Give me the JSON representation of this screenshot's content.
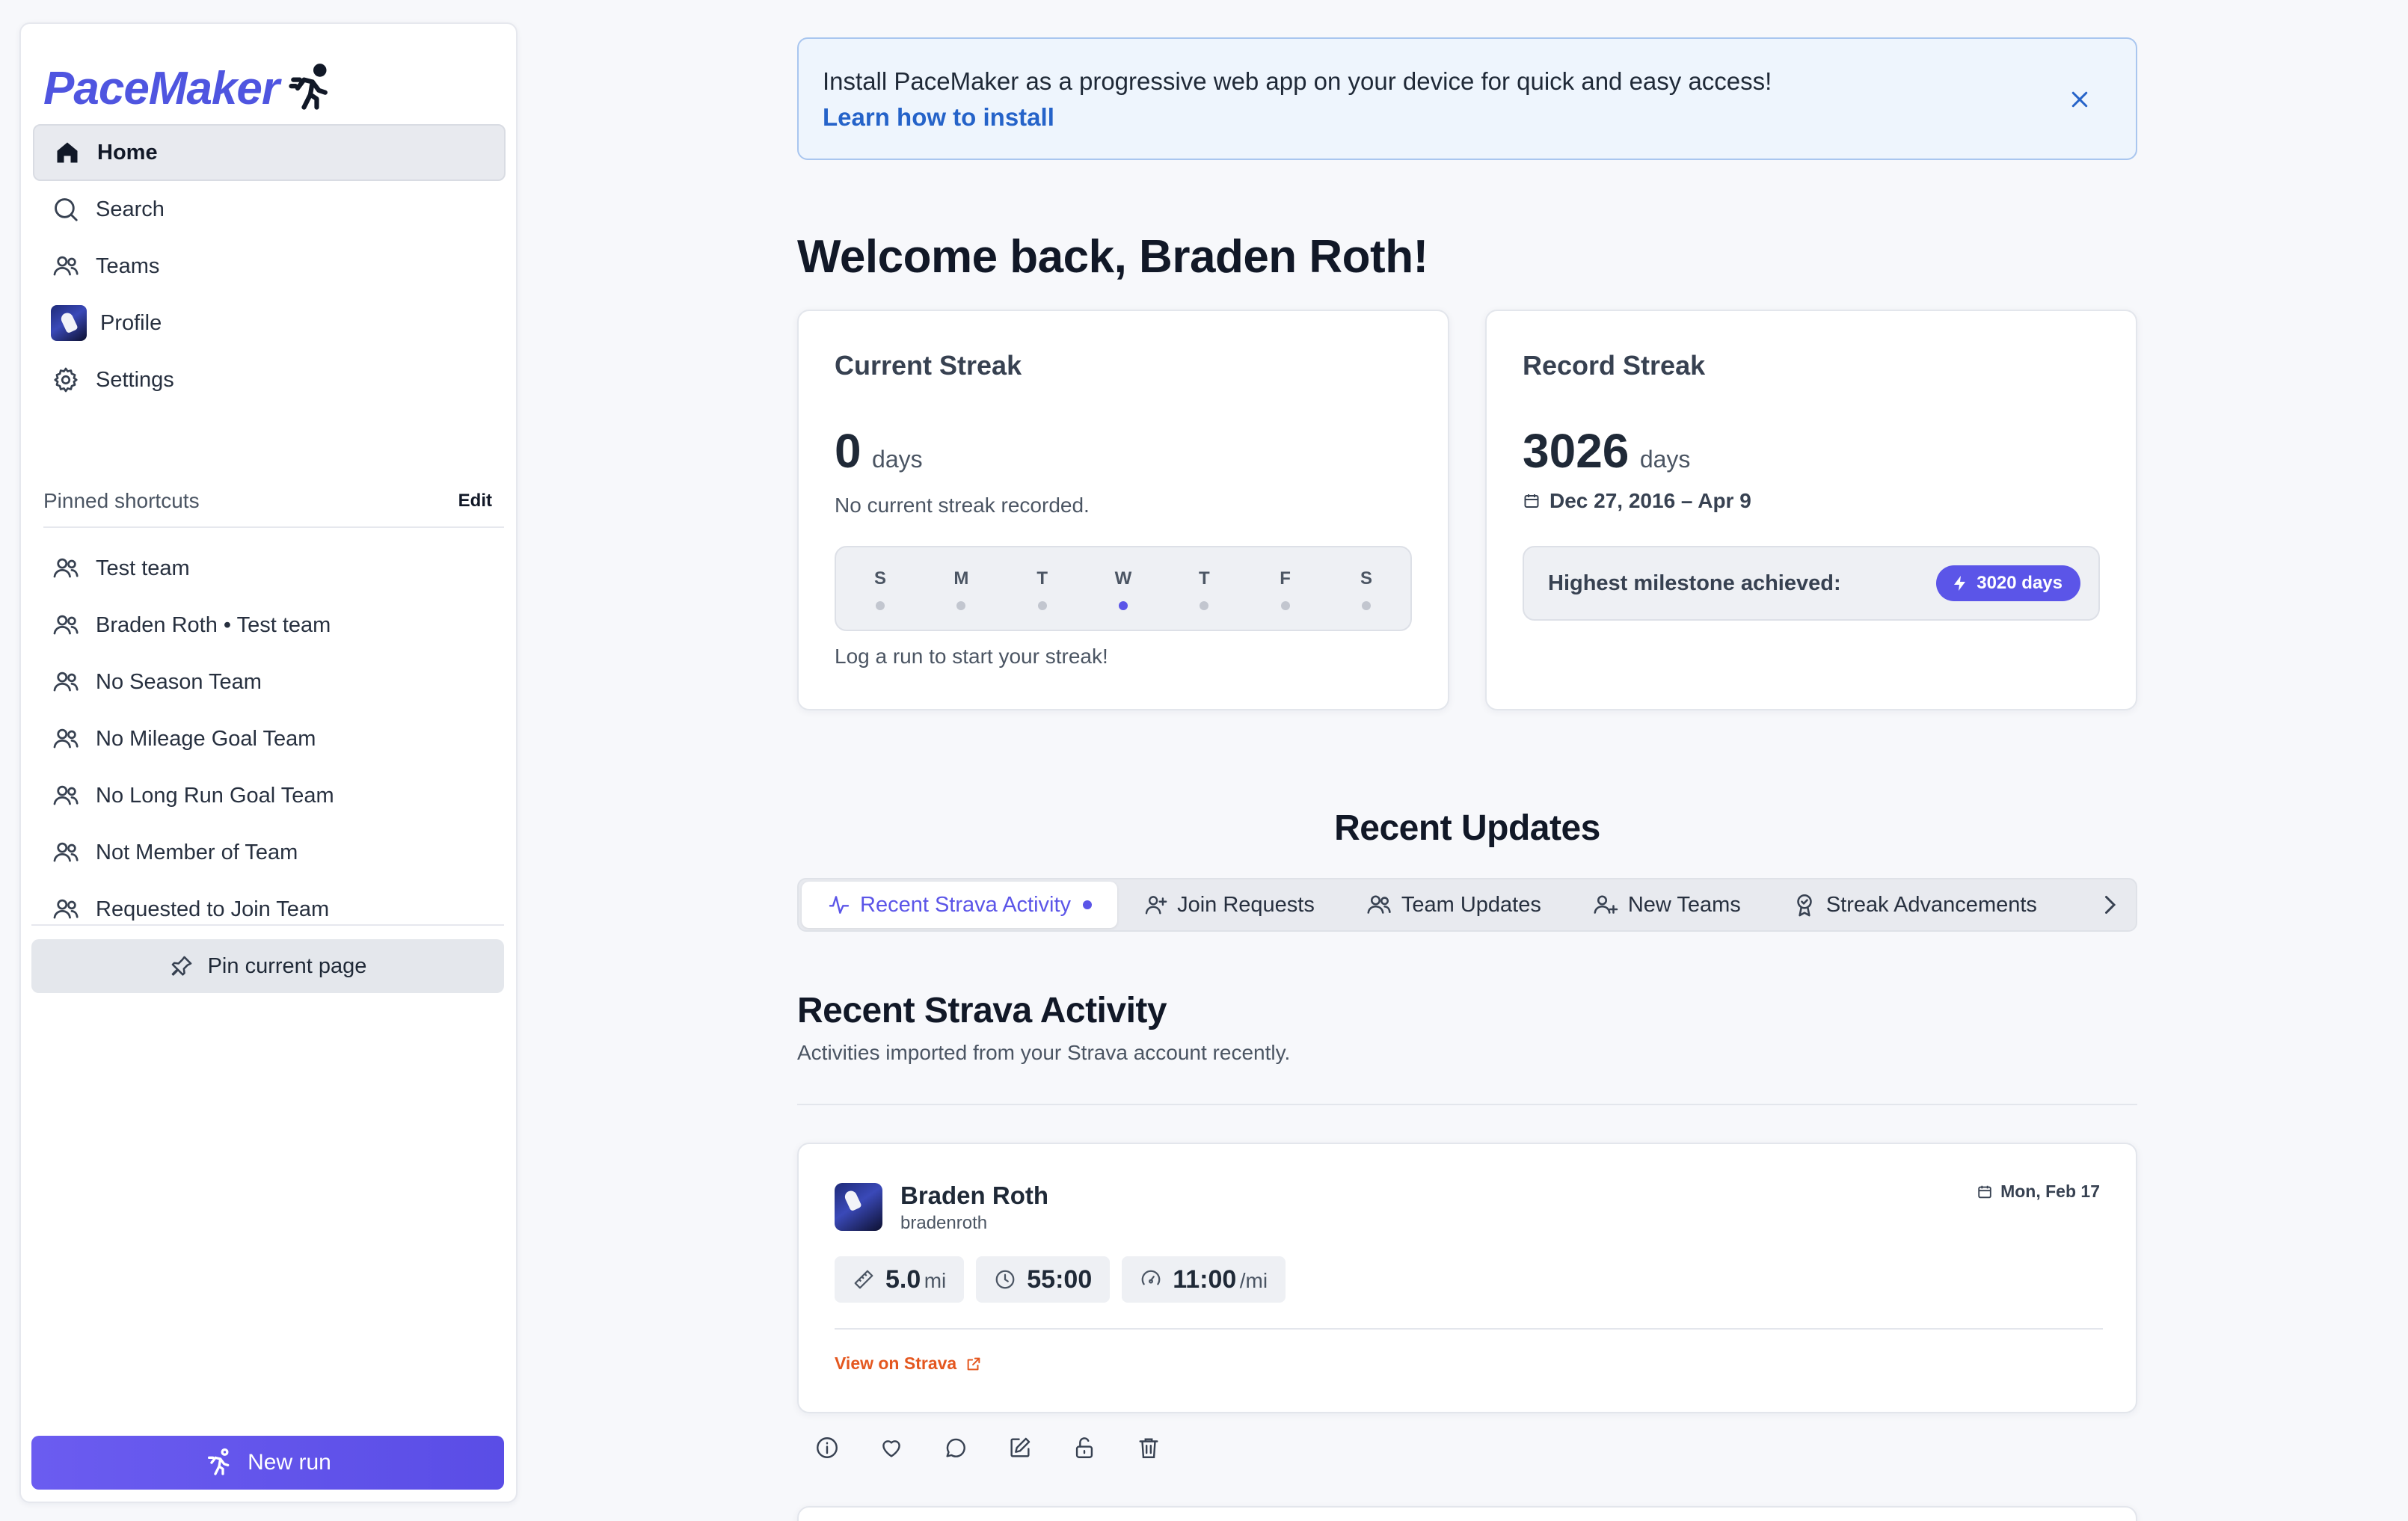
{
  "app": {
    "name": "PaceMaker"
  },
  "sidebar": {
    "nav": [
      {
        "label": "Home",
        "icon": "home-icon"
      },
      {
        "label": "Search",
        "icon": "search-icon"
      },
      {
        "label": "Teams",
        "icon": "users-icon"
      },
      {
        "label": "Profile",
        "icon": "avatar"
      },
      {
        "label": "Settings",
        "icon": "gear-icon"
      }
    ],
    "pinned_title": "Pinned shortcuts",
    "pinned_edit": "Edit",
    "pinned": [
      "Test team",
      "Braden Roth • Test team",
      "No Season Team",
      "No Mileage Goal Team",
      "No Long Run Goal Team",
      "Not Member of Team",
      "Requested to Join Team"
    ],
    "pin_button": "Pin current page",
    "new_run_button": "New run"
  },
  "banner": {
    "text": "Install PaceMaker as a progressive web app on your device for quick and easy access!",
    "link": "Learn how to install"
  },
  "welcome": "Welcome back, Braden Roth!",
  "current_streak": {
    "title": "Current Streak",
    "value": "0",
    "unit": "days",
    "note": "No current streak recorded.",
    "days": [
      "S",
      "M",
      "T",
      "W",
      "T",
      "F",
      "S"
    ],
    "today_index": 3,
    "cta": "Log a run to start your streak!"
  },
  "record_streak": {
    "title": "Record Streak",
    "value": "3026",
    "unit": "days",
    "range": "Dec 27, 2016 – Apr 9",
    "milestone_label": "Highest milestone achieved:",
    "milestone_badge": "3020 days"
  },
  "recent_updates": {
    "title": "Recent Updates",
    "tabs": [
      {
        "label": "Recent Strava Activity",
        "icon": "activity-icon"
      },
      {
        "label": "Join Requests",
        "icon": "user-plus-icon"
      },
      {
        "label": "Team Updates",
        "icon": "users-icon"
      },
      {
        "label": "New Teams",
        "icon": "users-plus-icon"
      },
      {
        "label": "Streak Advancements",
        "icon": "award-icon"
      }
    ]
  },
  "strava": {
    "title": "Recent Strava Activity",
    "subtitle": "Activities imported from your Strava account recently.",
    "activity": {
      "name": "Braden Roth",
      "username": "bradenroth",
      "date": "Mon, Feb 17",
      "distance": "5.0",
      "distance_unit": "mi",
      "time": "55:00",
      "pace": "11:00",
      "pace_unit": "/mi",
      "link": "View on Strava"
    }
  },
  "colors": {
    "accent": "#5b55e8",
    "strava": "#e4571f",
    "link": "#2563c9"
  }
}
